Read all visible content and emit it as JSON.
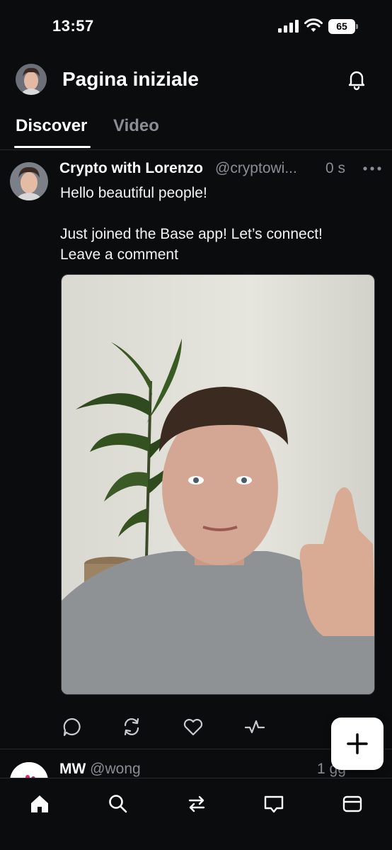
{
  "status_bar": {
    "time": "13:57",
    "battery": "65"
  },
  "header": {
    "title": "Pagina iniziale"
  },
  "tabs": [
    {
      "label": "Discover",
      "active": true
    },
    {
      "label": "Video",
      "active": false
    }
  ],
  "post": {
    "author_name": "Crypto with Lorenzo",
    "author_handle": "@cryptowi...",
    "time": "0 s",
    "body": [
      "Hello beautiful people!",
      "",
      "Just joined the Base app! Let’s connect!",
      "Leave a comment"
    ],
    "actions": [
      "comment-icon",
      "repost-icon",
      "heart-icon",
      "activity-icon"
    ]
  },
  "next_post": {
    "author_name": "MW",
    "author_handle": "@wong",
    "time": "1 gg"
  },
  "bottom_nav": [
    "home-icon",
    "search-icon",
    "swap-icon",
    "messages-icon",
    "wallet-icon"
  ],
  "colors": {
    "background": "#0b0c0e",
    "text": "#ffffff",
    "muted": "#8b8d94",
    "divider": "#2a2b2f"
  }
}
